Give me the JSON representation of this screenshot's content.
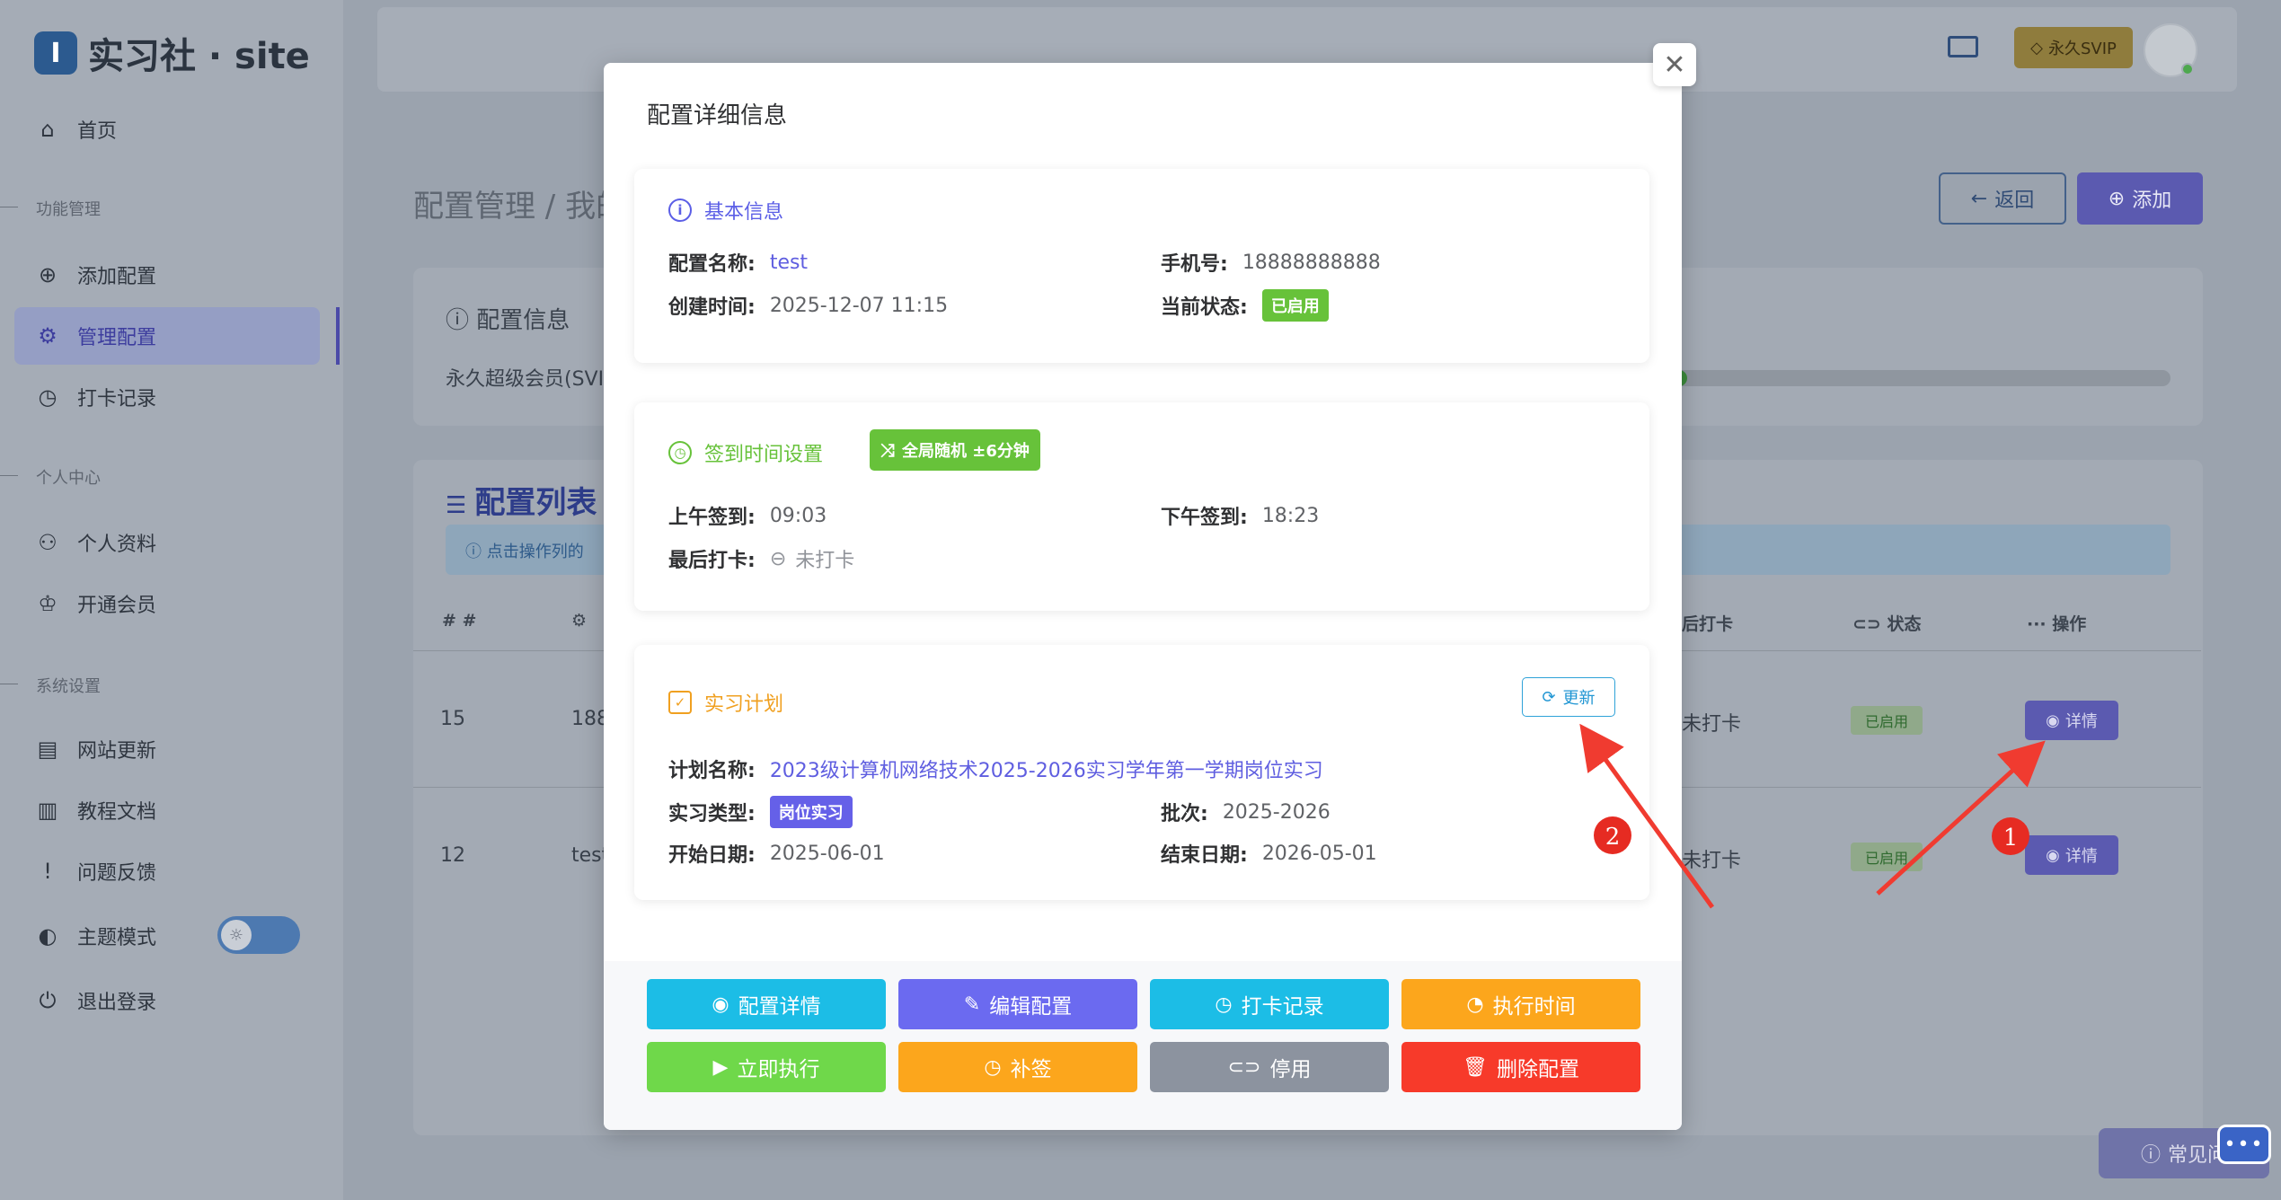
{
  "app": {
    "logo_mark": "I",
    "logo_text": "实习社 · site"
  },
  "sidebar": {
    "home": "首页",
    "section_func": "功能管理",
    "add_config": "添加配置",
    "manage_config": "管理配置",
    "checkin_records": "打卡记录",
    "section_personal": "个人中心",
    "profile": "个人资料",
    "membership": "开通会员",
    "section_system": "系统设置",
    "site_update": "网站更新",
    "docs": "教程文档",
    "feedback": "问题反馈",
    "theme": "主题模式",
    "logout": "退出登录"
  },
  "topbar": {
    "svip": "永久SVIP"
  },
  "page": {
    "crumb": "配置管理 / 我的",
    "back": "返回",
    "add": "添加",
    "info_title": "配置信息",
    "member_text": "永久超级会员(SVI",
    "list_title": "配置列表",
    "hint": "点击操作列的",
    "col_hash": "# #",
    "col_last": "后打卡",
    "col_status": "状态",
    "col_action": "操作",
    "rows": [
      {
        "id": "15",
        "name": "188",
        "last": "未打卡",
        "status": "已启用",
        "action": "详情"
      },
      {
        "id": "12",
        "name": "test",
        "last": "未打卡",
        "status": "已启用",
        "action": "详情"
      }
    ],
    "faq": "常见问"
  },
  "modal": {
    "title": "配置详细信息",
    "basic": {
      "heading": "基本信息",
      "name_k": "配置名称:",
      "name_v": "test",
      "phone_k": "手机号:",
      "phone_v": "18888888888",
      "created_k": "创建时间:",
      "created_v": "2025-12-07 11:15",
      "status_k": "当前状态:",
      "status_v": "已启用"
    },
    "time": {
      "heading": "签到时间设置",
      "random_tag": "全局随机 ±6分钟",
      "am_k": "上午签到:",
      "am_v": "09:03",
      "pm_k": "下午签到:",
      "pm_v": "18:23",
      "last_k": "最后打卡:",
      "last_v": "未打卡"
    },
    "plan": {
      "heading": "实习计划",
      "refresh": "更新",
      "plan_k": "计划名称:",
      "plan_v": "2023级计算机网络技术2025-2026实习学年第一学期岗位实习",
      "type_k": "实习类型:",
      "type_v": "岗位实习",
      "batch_k": "批次:",
      "batch_v": "2025-2026",
      "start_k": "开始日期:",
      "start_v": "2025-06-01",
      "end_k": "结束日期:",
      "end_v": "2026-05-01"
    },
    "buttons": {
      "detail": "配置详情",
      "edit": "编辑配置",
      "records": "打卡记录",
      "exec_time": "执行时间",
      "run_now": "立即执行",
      "makeup": "补签",
      "disable": "停用",
      "delete": "删除配置"
    }
  },
  "annotations": {
    "one": "1",
    "two": "2"
  },
  "colors": {
    "cyan": "#1cbde6",
    "purple": "#6b6af0",
    "orange": "#fca61c",
    "green": "#6fd84a",
    "gray": "#8c939f",
    "red": "#f73a2a",
    "arrow": "#f03b30"
  }
}
